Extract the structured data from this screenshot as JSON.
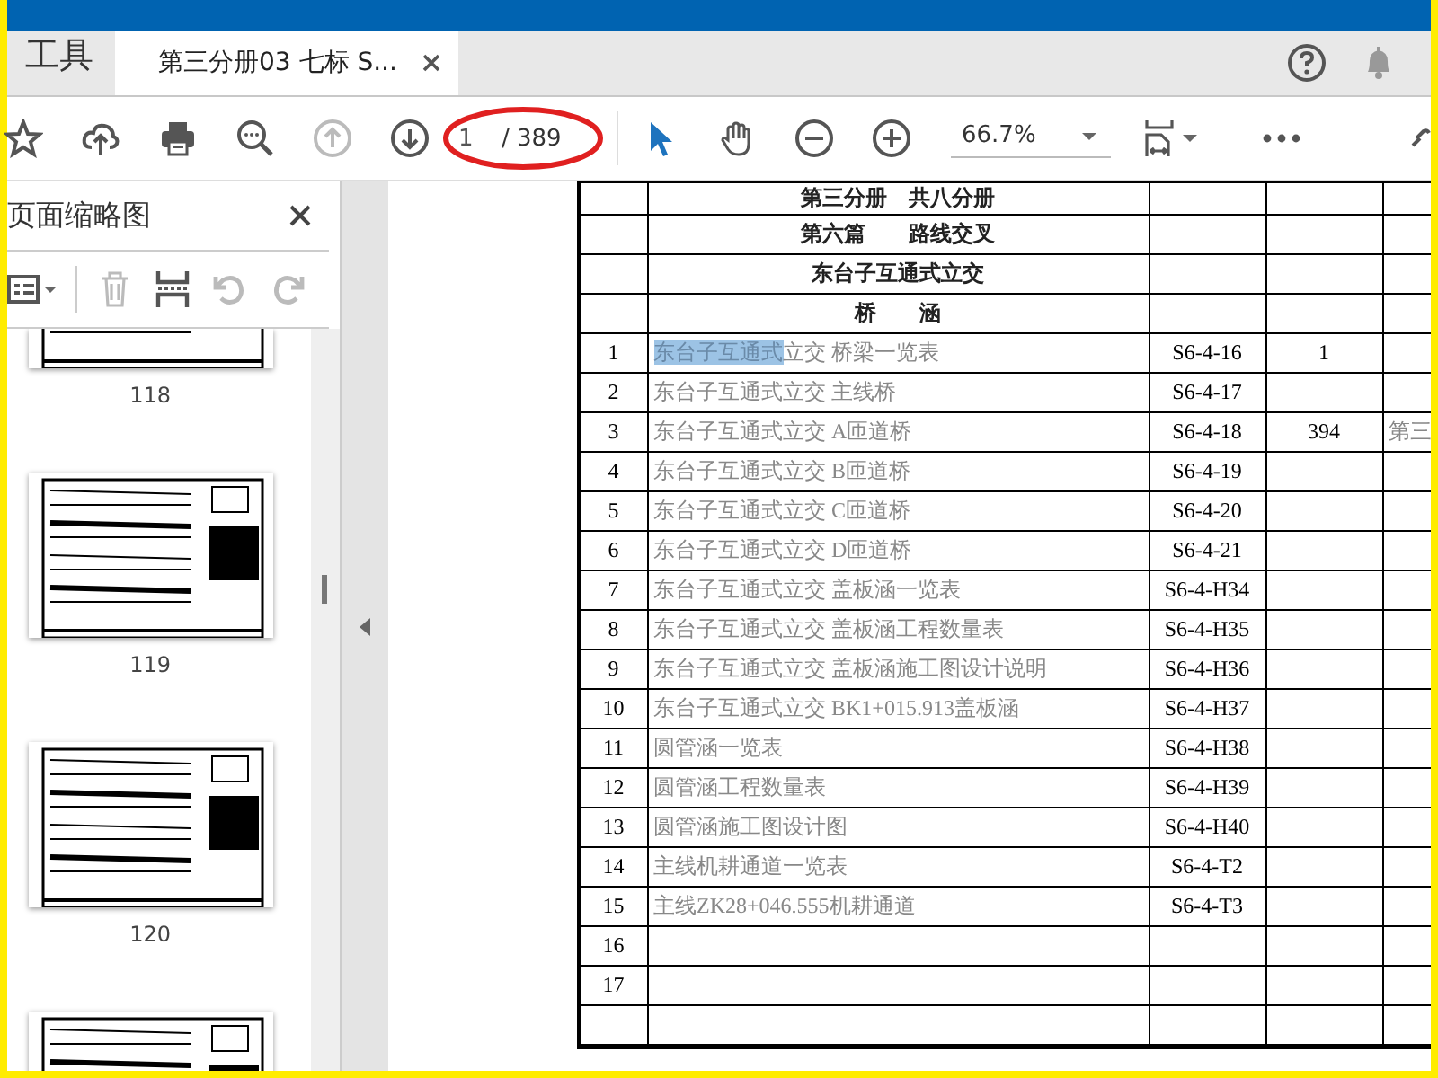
{
  "tab_bar": {
    "tools_label": "工具",
    "tabs": [
      {
        "label": "第三分册03 七标 S...",
        "selected": true
      }
    ]
  },
  "toolbar": {
    "page_input": {
      "value": "1"
    },
    "page_total": "/ 389",
    "zoom": "66.7%",
    "annotation": {
      "kind": "ellipse"
    }
  },
  "thumbnail_panel": {
    "title": "页面缩略图",
    "thumbnails": [
      {
        "label": "118",
        "kind": "cut-top"
      },
      {
        "label": "119",
        "kind": "whole"
      },
      {
        "label": "120",
        "kind": "whole"
      },
      {
        "kind": "cut-bottom"
      }
    ]
  },
  "document_table": {
    "rows": [
      {
        "kind": "heading",
        "text": "第三分册　共八分册"
      },
      {
        "kind": "heading",
        "text": "第六篇　　路线交叉"
      },
      {
        "kind": "heading",
        "text": "东台子互通式立交"
      },
      {
        "kind": "heading",
        "text": "桥　　涵"
      },
      {
        "kind": "entry",
        "number": "1",
        "title_selected": "东台子互通式",
        "title": "立交 桥梁一览表",
        "code": "S6-4-16",
        "column_4": "1"
      },
      {
        "kind": "entry",
        "number": "2",
        "title": "东台子互通式立交 主线桥",
        "code": "S6-4-17"
      },
      {
        "kind": "entry",
        "number": "3",
        "title": "东台子互通式立交 A匝道桥",
        "code": "S6-4-18",
        "column_4": "394",
        "column_5": "第三"
      },
      {
        "kind": "entry",
        "number": "4",
        "title": "东台子互通式立交 B匝道桥",
        "code": "S6-4-19"
      },
      {
        "kind": "entry",
        "number": "5",
        "title": "东台子互通式立交 C匝道桥",
        "code": "S6-4-20"
      },
      {
        "kind": "entry",
        "number": "6",
        "title": "东台子互通式立交 D匝道桥",
        "code": "S6-4-21"
      },
      {
        "kind": "entry",
        "number": "7",
        "title": "东台子互通式立交 盖板涵一览表",
        "code": "S6-4-H34"
      },
      {
        "kind": "entry",
        "number": "8",
        "title": "东台子互通式立交 盖板涵工程数量表",
        "code": "S6-4-H35"
      },
      {
        "kind": "entry",
        "number": "9",
        "title": "东台子互通式立交 盖板涵施工图设计说明",
        "code": "S6-4-H36"
      },
      {
        "kind": "entry",
        "number": "10",
        "title": "东台子互通式立交  BK1+015.913盖板涵",
        "code": "S6-4-H37"
      },
      {
        "kind": "entry",
        "number": "11",
        "title": "圆管涵一览表",
        "code": "S6-4-H38"
      },
      {
        "kind": "entry",
        "number": "12",
        "title": "圆管涵工程数量表",
        "code": "S6-4-H39"
      },
      {
        "kind": "entry",
        "number": "13",
        "title": "圆管涵施工图设计图",
        "code": "S6-4-H40"
      },
      {
        "kind": "entry",
        "number": "14",
        "title": "主线机耕通道一览表",
        "code": "S6-4-T2"
      },
      {
        "kind": "entry",
        "number": "15",
        "title": "主线ZK28+046.555机耕通道",
        "code": "S6-4-T3"
      },
      {
        "kind": "entry",
        "number": "16"
      },
      {
        "kind": "entry",
        "number": "17"
      },
      {
        "kind": "blank"
      }
    ]
  }
}
